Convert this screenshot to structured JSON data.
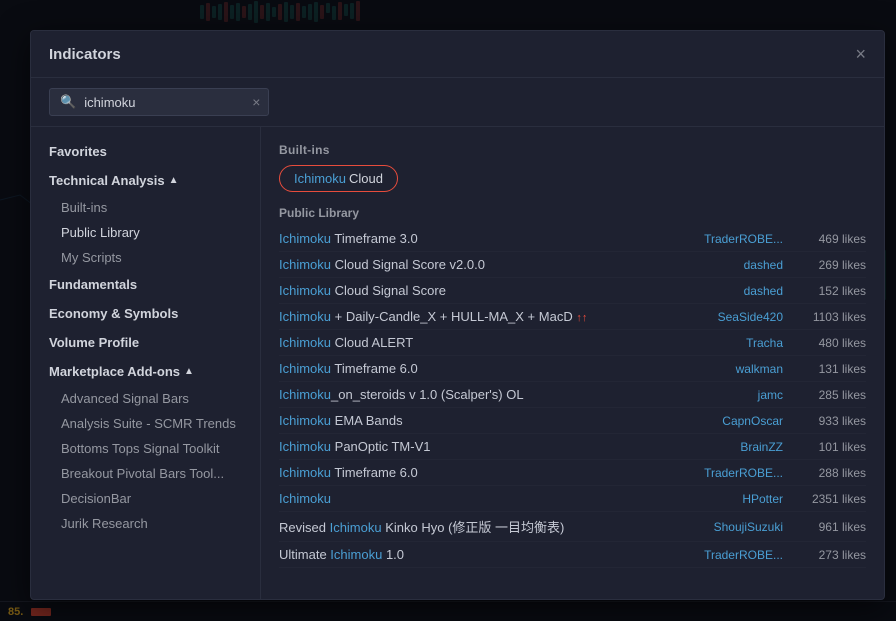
{
  "panel": {
    "title": "Indicators",
    "close_label": "×"
  },
  "search": {
    "value": "ichimoku",
    "placeholder": "ichimoku",
    "clear_label": "×",
    "icon": "🔍"
  },
  "sidebar": {
    "items": [
      {
        "id": "favorites",
        "label": "Favorites",
        "type": "section",
        "indent": 0
      },
      {
        "id": "technical-analysis",
        "label": "Technical Analysis",
        "type": "section",
        "indent": 0,
        "expanded": true,
        "caret": "▲"
      },
      {
        "id": "builtins",
        "label": "Built-ins",
        "type": "sub",
        "indent": 1
      },
      {
        "id": "public-library",
        "label": "Public Library",
        "type": "sub",
        "indent": 1
      },
      {
        "id": "my-scripts",
        "label": "My Scripts",
        "type": "sub",
        "indent": 1
      },
      {
        "id": "fundamentals",
        "label": "Fundamentals",
        "type": "section",
        "indent": 0
      },
      {
        "id": "economy-symbols",
        "label": "Economy & Symbols",
        "type": "section",
        "indent": 0
      },
      {
        "id": "volume-profile",
        "label": "Volume Profile",
        "type": "section",
        "indent": 0
      },
      {
        "id": "marketplace-addons",
        "label": "Marketplace Add-ons",
        "type": "section",
        "indent": 0,
        "expanded": true,
        "caret": "▲"
      },
      {
        "id": "advanced-signal-bars",
        "label": "Advanced Signal Bars",
        "type": "sub",
        "indent": 1
      },
      {
        "id": "analysis-suite",
        "label": "Analysis Suite - SCMR Trends",
        "type": "sub",
        "indent": 1
      },
      {
        "id": "bottoms-tops",
        "label": "Bottoms Tops Signal Toolkit",
        "type": "sub",
        "indent": 1
      },
      {
        "id": "breakout-pivotal",
        "label": "Breakout Pivotal Bars Tool...",
        "type": "sub",
        "indent": 1
      },
      {
        "id": "decisionbar",
        "label": "DecisionBar",
        "type": "sub",
        "indent": 1
      },
      {
        "id": "jurik-research",
        "label": "Jurik Research",
        "type": "sub",
        "indent": 1
      }
    ]
  },
  "content": {
    "builtins_header": "Built-ins",
    "builtin_pill": {
      "highlight": "Ichimoku",
      "rest": " Cloud"
    },
    "public_library_header": "Public Library",
    "results": [
      {
        "name_highlight": "Ichimoku",
        "name_rest": " Timeframe 3.0",
        "author": "TraderROBE...",
        "likes": "469 likes"
      },
      {
        "name_highlight": "Ichimoku",
        "name_rest": " Cloud Signal Score v2.0.0",
        "author": "dashed",
        "likes": "269 likes"
      },
      {
        "name_highlight": "Ichimoku",
        "name_rest": " Cloud Signal Score",
        "author": "dashed",
        "likes": "152 likes"
      },
      {
        "name_highlight": "Ichimoku",
        "name_rest": " + Daily-Candle_X + HULL-MA_X + MacD",
        "name_suffix": "↑↑",
        "author": "SeaSide420",
        "likes": "1103 likes"
      },
      {
        "name_highlight": "Ichimoku",
        "name_rest": " Cloud ALERT",
        "author": "Tracha",
        "likes": "480 likes"
      },
      {
        "name_highlight": "Ichimoku",
        "name_rest": " Timeframe 6.0",
        "author": "walkman",
        "likes": "131 likes"
      },
      {
        "name_highlight": "Ichimoku",
        "name_rest": "_on_steroids v 1.0 (Scalper's) OL",
        "author": "jamc",
        "likes": "285 likes"
      },
      {
        "name_highlight": "Ichimoku",
        "name_rest": " EMA Bands",
        "author": "CapnOscar",
        "likes": "933 likes"
      },
      {
        "name_highlight": "Ichimoku",
        "name_rest": " PanOptic TM-V1",
        "author": "BrainZZ",
        "likes": "101 likes"
      },
      {
        "name_highlight": "Ichimoku",
        "name_rest": " Timeframe 6.0",
        "author": "TraderROBE...",
        "likes": "288 likes"
      },
      {
        "name_highlight": "Ichimoku",
        "name_rest": "",
        "author": "HPotter",
        "likes": "2351 likes"
      },
      {
        "name_prefix": "Revised ",
        "name_highlight": "Ichimoku",
        "name_rest": " Kinko Hyo (修正版 一目均衡表)",
        "author": "ShoujiSuzuki",
        "likes": "961 likes"
      },
      {
        "name_prefix": "Ultimate ",
        "name_highlight": "Ichimoku",
        "name_rest": " 1.0",
        "author": "TraderROBE...",
        "likes": "273 likes"
      }
    ]
  },
  "bottom": {
    "price": "85."
  }
}
